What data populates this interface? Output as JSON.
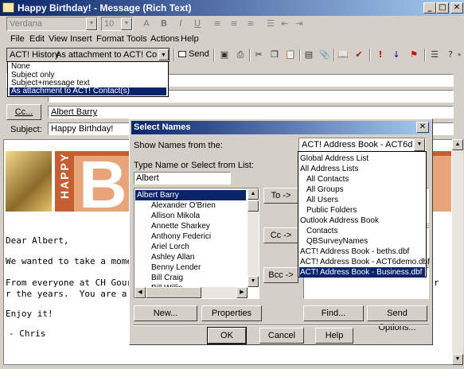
{
  "window": {
    "title": "Happy Birthday! - Message (Rich Text)",
    "minimize": "_",
    "maximize": "□",
    "close": "✕"
  },
  "format_toolbar": {
    "font": "Verdana",
    "size": "10",
    "bold": "B",
    "italic": "I",
    "underline": "U"
  },
  "menu": {
    "file": "File",
    "edit": "Edit",
    "view": "View",
    "insert": "Insert",
    "format": "Format",
    "tools": "Tools",
    "actions": "Actions",
    "help": "Help"
  },
  "std_toolbar": {
    "act_history_label": "ACT! History",
    "act_history_value": "As attachment to ACT! Contact",
    "send": "Send",
    "history_options": [
      "None",
      "Subject only",
      "Subject+message text",
      "As attachment to ACT! Contact(s)"
    ]
  },
  "header": {
    "cc_button": "Cc...",
    "cc_value": "Albert Barry",
    "subject_label": "Subject:",
    "subject_value": "Happy Birthday!"
  },
  "banner": {
    "happy": "HAPPY",
    "b": "B"
  },
  "body_lines": [
    "Dear Albert,",
    "We wanted to take a mome",
    "From everyone at CH Gourm",
    "r the years.  You are a very",
    "Enjoy it!",
    "- Chris"
  ],
  "body_overflow_letter": "r",
  "dialog": {
    "title": "Select Names",
    "close": "✕",
    "show_names_label": "Show Names from the:",
    "show_names_value": "ACT! Address Book - ACT6demo.dbf",
    "type_name_label": "Type Name or Select from List:",
    "type_name_value": "Albert",
    "names": [
      "Albert Barry",
      "Alexander O'Brien",
      "Allison Mikola",
      "Annette Sharkey",
      "Anthony Federici",
      "Ariel Lorch",
      "Ashley Allan",
      "Benny Lender",
      "Bill Craig",
      "Bill Willis"
    ],
    "to_button": "To ->",
    "cc_button": "Cc ->",
    "bcc_button": "Bcc ->",
    "new_button": "New...",
    "properties_button": "Properties",
    "find_button": "Find...",
    "send_options_button": "Send Options...",
    "ok_button": "OK",
    "cancel_button": "Cancel",
    "help_button": "Help"
  },
  "address_books": [
    {
      "label": "Global Address List",
      "indent": false
    },
    {
      "label": "All Address Lists",
      "indent": false
    },
    {
      "label": "All Contacts",
      "indent": true
    },
    {
      "label": "All Groups",
      "indent": true
    },
    {
      "label": "All Users",
      "indent": true
    },
    {
      "label": "Public Folders",
      "indent": true
    },
    {
      "label": "Outlook Address Book",
      "indent": false
    },
    {
      "label": "Contacts",
      "indent": true
    },
    {
      "label": "QBSurveyNames",
      "indent": true
    },
    {
      "label": "ACT! Address Book - beths.dbf",
      "indent": false
    },
    {
      "label": "ACT! Address Book - ACT6demo.dbf",
      "indent": false
    },
    {
      "label": "ACT! Address Book - Business.dbf",
      "indent": false
    }
  ],
  "colors": {
    "title_bar": "#0a246a",
    "selection": "#0a246a",
    "banner": "#c55e31"
  }
}
